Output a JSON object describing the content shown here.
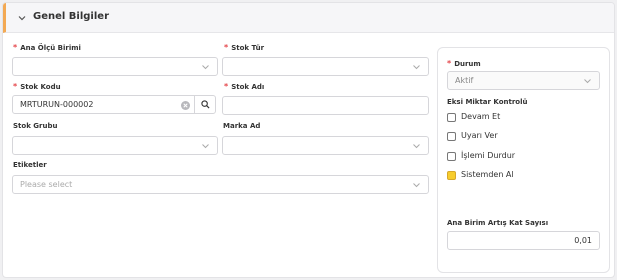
{
  "panel": {
    "title": "Genel Bilgiler"
  },
  "fields": {
    "ana_olcu_birimi": {
      "label": "Ana Ölçü Birimi",
      "value": ""
    },
    "stok_tur": {
      "label": "Stok Tür",
      "value": ""
    },
    "stok_kodu": {
      "label": "Stok Kodu",
      "value": "MRTURUN-000002"
    },
    "stok_adi": {
      "label": "Stok Adı",
      "value": ""
    },
    "stok_grubu": {
      "label": "Stok Grubu",
      "value": ""
    },
    "marka_ad": {
      "label": "Marka Ad",
      "value": ""
    },
    "etiketler": {
      "label": "Etiketler",
      "placeholder": "Please select"
    }
  },
  "side": {
    "durum": {
      "label": "Durum",
      "value": "Aktif"
    },
    "eksi_miktar": {
      "label": "Eksi Miktar Kontrolü",
      "options": [
        {
          "label": "Devam Et",
          "checked": false
        },
        {
          "label": "Uyarı Ver",
          "checked": false
        },
        {
          "label": "İşlemi Durdur",
          "checked": false
        },
        {
          "label": "Sistemden Al",
          "checked": true
        }
      ]
    },
    "artis_kat": {
      "label": "Ana Birim Artış Kat Sayısı",
      "value": "0,01"
    }
  },
  "colors": {
    "accent": "#f3a953",
    "required": "#e5484d",
    "checked": "#f7cd2d"
  },
  "icons": [
    "chevron-down-icon",
    "clear-icon",
    "search-icon"
  ]
}
